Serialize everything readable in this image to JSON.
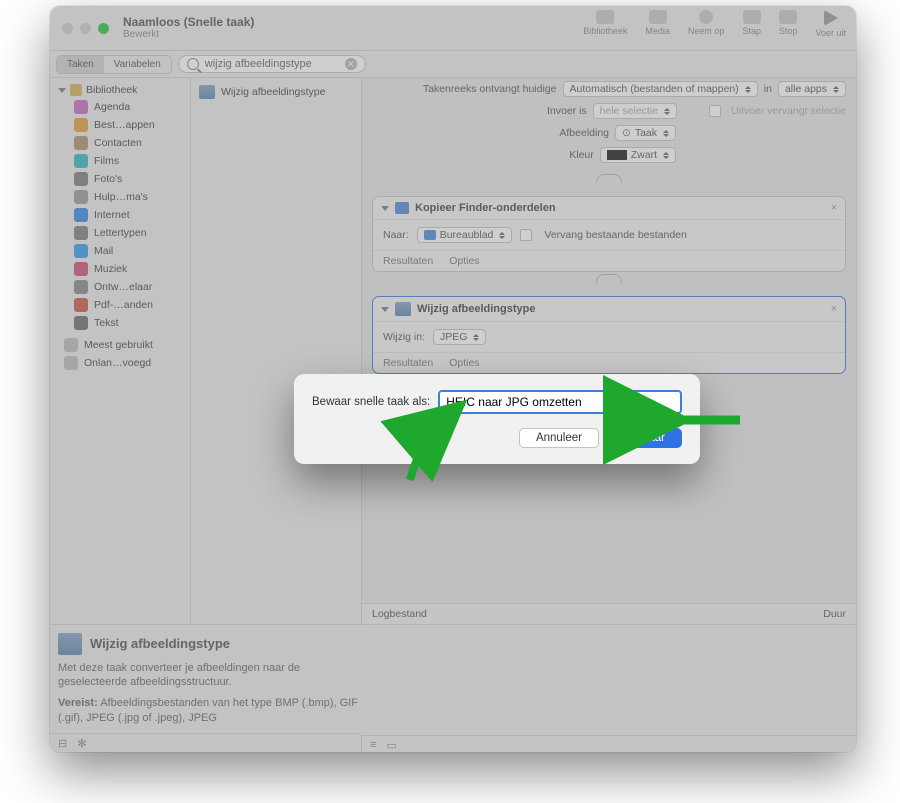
{
  "window": {
    "title": "Naamloos (Snelle taak)",
    "subtitle": "Bewerkt"
  },
  "toolbar_right": [
    {
      "label": "Bibliotheek",
      "icon": "rect"
    },
    {
      "label": "Media",
      "icon": "rect"
    },
    {
      "label": "Neem op",
      "icon": "circle"
    },
    {
      "label": "Stap",
      "icon": "rect"
    },
    {
      "label": "Stop",
      "icon": "rect"
    },
    {
      "label": "Voer uit",
      "icon": "play"
    }
  ],
  "seg": {
    "a": "Taken",
    "b": "Variabelen"
  },
  "search_value": "wijzig afbeeldingstype",
  "sidebar": {
    "header": "Bibliotheek",
    "items": [
      {
        "label": "Agenda",
        "c": "#c76dc6"
      },
      {
        "label": "Best…appen",
        "c": "#e2a13b"
      },
      {
        "label": "Contacten",
        "c": "#b09272"
      },
      {
        "label": "Films",
        "c": "#35b6c4"
      },
      {
        "label": "Foto's",
        "c": "#7e7e7e"
      },
      {
        "label": "Hulp…ma's",
        "c": "#9c9c9c"
      },
      {
        "label": "Internet",
        "c": "#3c87e0"
      },
      {
        "label": "Lettertypen",
        "c": "#7e7e7e"
      },
      {
        "label": "Mail",
        "c": "#2fa4e7"
      },
      {
        "label": "Muziek",
        "c": "#cf4f7a"
      },
      {
        "label": "Ontw…elaar",
        "c": "#8a8a8a"
      },
      {
        "label": "Pdf-…anden",
        "c": "#cf5a45"
      },
      {
        "label": "Tekst",
        "c": "#6e6e6e"
      }
    ],
    "extra": [
      {
        "label": "Meest gebruikt"
      },
      {
        "label": "Onlan…voegd"
      }
    ]
  },
  "mid_action": "Wijzig afbeeldingstype",
  "params": {
    "row1_label": "Takenreeks ontvangt huidige",
    "row1_val": "Automatisch (bestanden of mappen)",
    "in": "in",
    "apps": "alle apps",
    "row2_label": "Invoer is",
    "row2_val": "hele selectie",
    "row2_chk": "Uitvoer vervangt selectie",
    "row3_label": "Afbeelding",
    "row3_val": "Taak",
    "row4_label": "Kleur",
    "row4_val": "Zwart"
  },
  "card1": {
    "title": "Kopieer Finder-onderdelen",
    "to_label": "Naar:",
    "to_val": "Bureaublad",
    "replace": "Vervang bestaande bestanden",
    "f1": "Resultaten",
    "f2": "Opties"
  },
  "card2": {
    "title": "Wijzig afbeeldingstype",
    "to_label": "Wijzig in:",
    "to_val": "JPEG",
    "f1": "Resultaten",
    "f2": "Opties"
  },
  "log": {
    "h1": "Logbestand",
    "h2": "Duur"
  },
  "desc": {
    "title": "Wijzig afbeeldingstype",
    "p1": "Met deze taak converteer je afbeeldingen naar de geselecteerde afbeeldingsstructuur.",
    "p2a": "Vereist:",
    "p2b": " Afbeeldingsbestanden van het type BMP (.bmp), GIF (.gif), JPEG (.jpg of .jpeg), JPEG"
  },
  "sheet": {
    "label": "Bewaar snelle taak als:",
    "value": "HEIC naar JPG omzetten",
    "cancel": "Annuleer",
    "save": "Bewaar"
  }
}
